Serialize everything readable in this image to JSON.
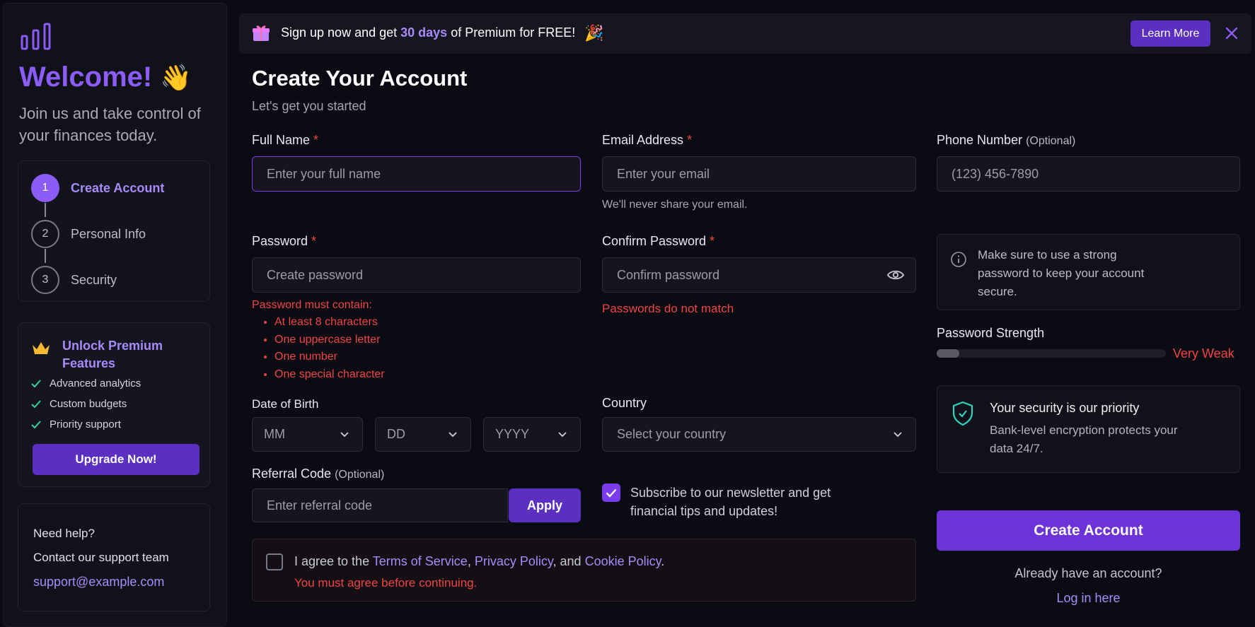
{
  "sidebar": {
    "welcome_title": "Welcome!",
    "welcome_emoji": "👋",
    "intro": "Join us and take control of your finances today.",
    "steps": [
      {
        "number": "1",
        "label": "Create Account",
        "active": true
      },
      {
        "number": "2",
        "label": "Personal Info",
        "active": false
      },
      {
        "number": "3",
        "label": "Security",
        "active": false
      }
    ],
    "premium": {
      "title": "Unlock Premium Features",
      "features": [
        "Advanced analytics",
        "Custom budgets",
        "Priority support"
      ],
      "button": "Upgrade Now!"
    },
    "help": {
      "line1": "Need help?",
      "line2": "Contact our support team",
      "email": "support@example.com"
    }
  },
  "banner": {
    "text_before": "Sign up now and get ",
    "highlight": "30 days",
    "text_after": " of Premium for FREE!",
    "party_emoji": "🎉",
    "learn_more": "Learn More"
  },
  "form": {
    "title": "Create Your Account",
    "subtitle": "Let's get you started",
    "full_name": {
      "label": "Full Name",
      "required": "*",
      "placeholder": "Enter your full name"
    },
    "email": {
      "label": "Email Address",
      "required": "*",
      "placeholder": "Enter your email",
      "hint": "We'll never share your email."
    },
    "phone": {
      "label": "Phone Number",
      "optional": "(Optional)",
      "placeholder": "(123) 456-7890"
    },
    "password": {
      "label": "Password",
      "required": "*",
      "placeholder": "Create password",
      "rules_title": "Password must contain:",
      "rules": [
        "At least 8 characters",
        "One uppercase letter",
        "One number",
        "One special character"
      ]
    },
    "confirm_password": {
      "label": "Confirm Password",
      "required": "*",
      "placeholder": "Confirm password",
      "error": "Passwords do not match"
    },
    "dob": {
      "label": "Date of Birth",
      "month": "MM",
      "day": "DD",
      "year": "YYYY"
    },
    "country": {
      "label": "Country",
      "placeholder": "Select your country"
    },
    "referral": {
      "label": "Referral Code",
      "optional": "(Optional)",
      "placeholder": "Enter referral code",
      "button": "Apply"
    },
    "newsletter": {
      "checked": true,
      "text": "Subscribe to our newsletter and get financial tips and updates!"
    },
    "terms": {
      "prefix": "I agree to the ",
      "tos": "Terms of Service",
      "sep1": ", ",
      "privacy": "Privacy Policy",
      "sep2": ", and ",
      "cookie": "Cookie Policy",
      "suffix": ".",
      "error": "You must agree before continuing."
    }
  },
  "right": {
    "info": "Make sure to use a strong password to keep your account secure.",
    "strength_label": "Password Strength",
    "strength_value": "Very Weak",
    "strength_fraction": 0.1,
    "security_title": "Your security is our priority",
    "security_desc": "Bank-level encryption protects your data 24/7.",
    "create_button": "Create Account",
    "already": "Already have an account?",
    "login": "Log in here"
  },
  "colors": {
    "accent": "#8b5cf6",
    "button": "#5b2fc2",
    "error": "#ef4444",
    "background": "#0b0c13"
  }
}
